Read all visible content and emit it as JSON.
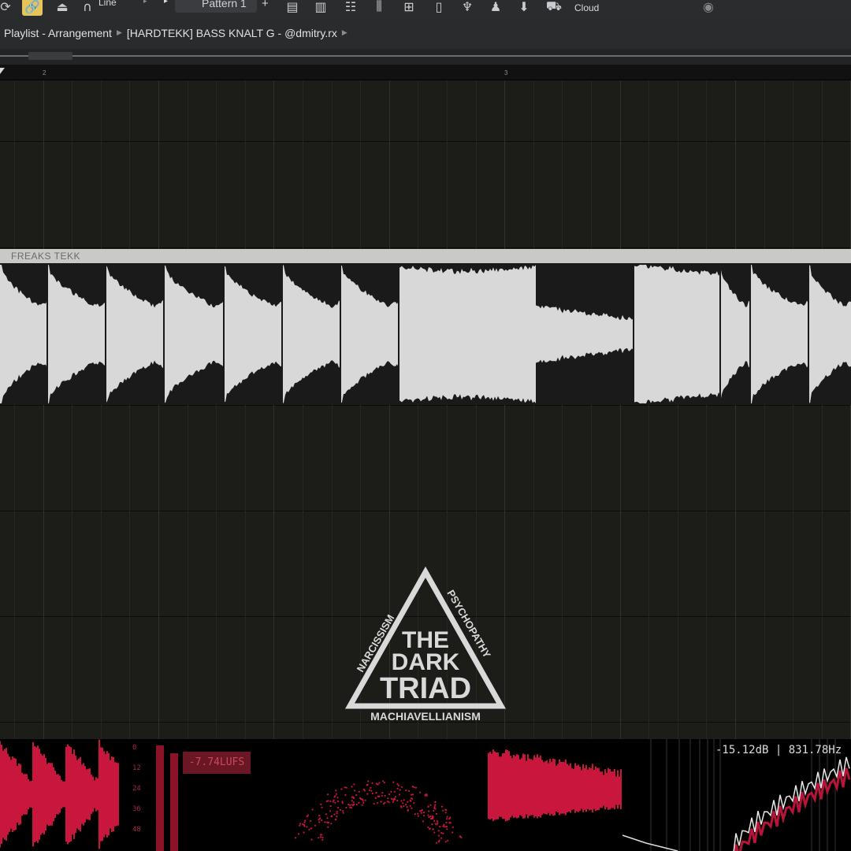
{
  "toolbar": {
    "snap_label": "Line",
    "pattern_label": "Pattern 1",
    "add_symbol": "+",
    "cloud_label": "Cloud"
  },
  "breadcrumb": {
    "part1": "Playlist - Arrangement",
    "part2": "[HARDTEKK] BASS KNALT G - @dmitry.rx"
  },
  "ruler": {
    "bar2": "2",
    "bar3": "3"
  },
  "clip": {
    "name": "FREAKS TEKK"
  },
  "logo": {
    "line1": "THE",
    "line2": "DARK",
    "line3": "TRIAD",
    "left": "NARCISSISM",
    "right": "PSYCHOPATHY",
    "bottom": "MACHIAVELLIANISM"
  },
  "analyzer": {
    "lufs": "-7.74LUFS",
    "readout": "-15.12dB | 831.78Hz",
    "db_labels": [
      "0",
      "12",
      "24",
      "36",
      "48"
    ]
  },
  "colors": {
    "accent": "#e6c45a",
    "waveform": "#d8d8d8",
    "meter": "#c8163c"
  }
}
